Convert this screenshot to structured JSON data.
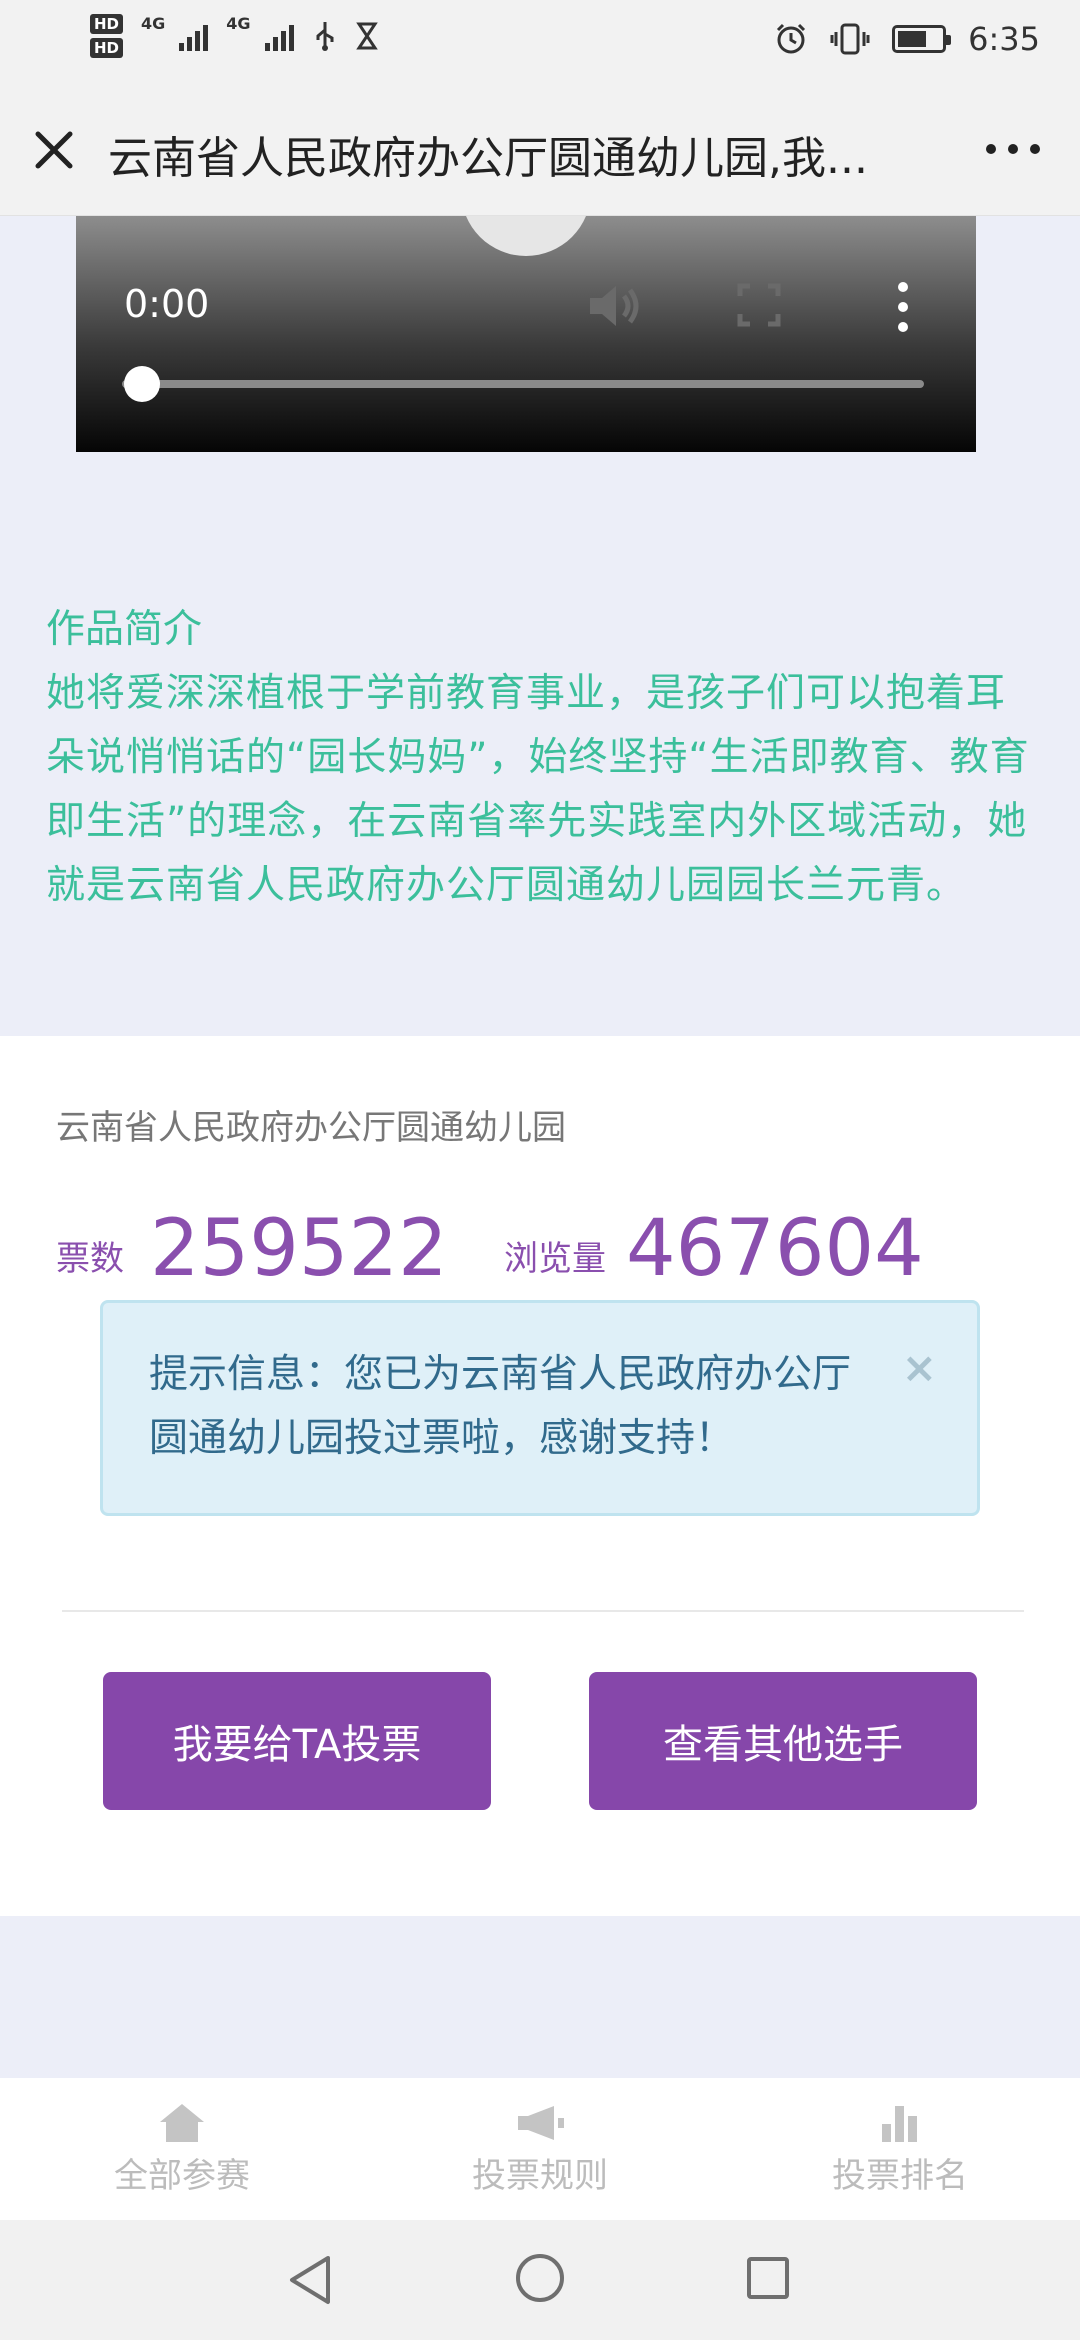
{
  "status_bar": {
    "network_1": "4G",
    "network_2": "4G",
    "time": "6:35"
  },
  "title_bar": {
    "title": "云南省人民政府办公厅圆通幼儿园,我..."
  },
  "video": {
    "current_time": "0:00",
    "progress": 0.0
  },
  "intro": {
    "heading": "作品简介",
    "text": "她将爱深深植根于学前教育事业，是孩子们可以抱着耳朵说悄悄话的“园长妈妈”，始终坚持“生活即教育、教育即生活”的理念，在云南省率先实践室内外区域活动，她就是云南省人民政府办公厅圆通幼儿园园长兰元青。"
  },
  "card": {
    "school_name": "云南省人民政府办公厅圆通幼儿园",
    "votes_label": "票数",
    "votes_value": "259522",
    "views_label": "浏览量",
    "views_value": "467604",
    "alert_text": "提示信息：您已为云南省人民政府办公厅圆通幼儿园投过票啦，感谢支持！",
    "alert_close": "×",
    "vote_button": "我要给TA投票",
    "others_button": "查看其他选手"
  },
  "tabs": [
    {
      "label": "全部参赛",
      "icon": "home-icon"
    },
    {
      "label": "投票规则",
      "icon": "megaphone-icon"
    },
    {
      "label": "投票排名",
      "icon": "bar-chart-icon"
    }
  ],
  "colors": {
    "accent_purple": "#8647aa",
    "intro_green": "#3bbf9b",
    "alert_bg": "#dff0f8",
    "alert_text": "#316a8c"
  }
}
